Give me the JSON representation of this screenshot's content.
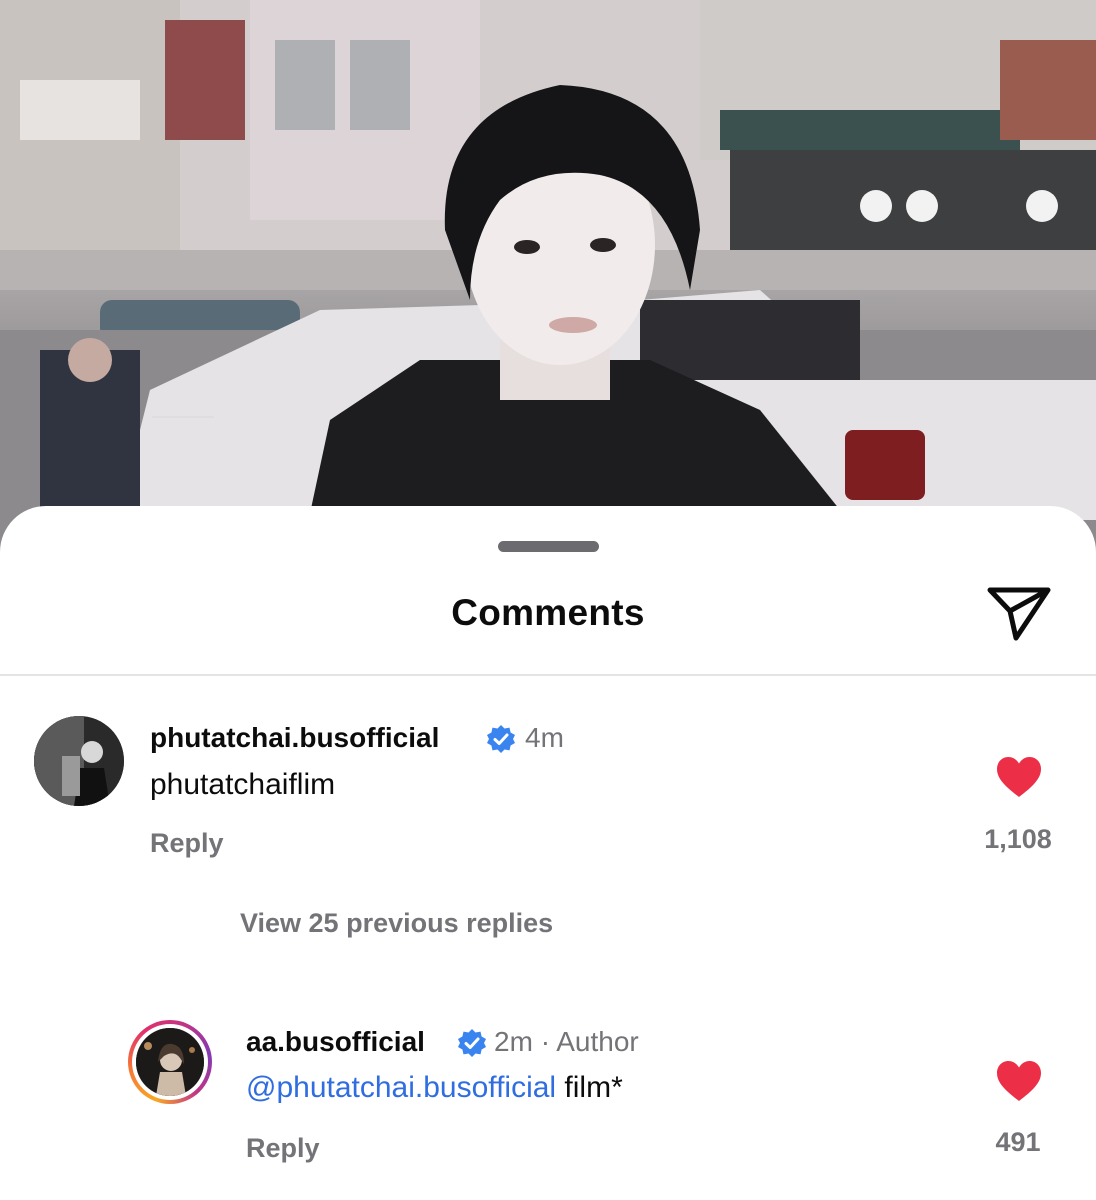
{
  "sheet": {
    "title": "Comments",
    "send_icon": "paper-plane-icon"
  },
  "comments": [
    {
      "username": "phutatchai.busofficial",
      "verified": true,
      "time": "4m",
      "text": "phutatchaiflim",
      "reply_label": "Reply",
      "likes": "1,108",
      "liked": true
    }
  ],
  "thread": {
    "view_replies_label": "View 25 previous replies"
  },
  "replies": [
    {
      "username": "aa.busofficial",
      "verified": true,
      "time": "2m",
      "separator": "·",
      "role": "Author",
      "mention": "@phutatchai.busofficial",
      "text": " film*",
      "reply_label": "Reply",
      "likes": "491",
      "liked": true
    }
  ],
  "colors": {
    "heart": "#ec2f47",
    "verified": "#3a84f0",
    "mention": "#2f6de1",
    "muted_text": "#737378"
  }
}
